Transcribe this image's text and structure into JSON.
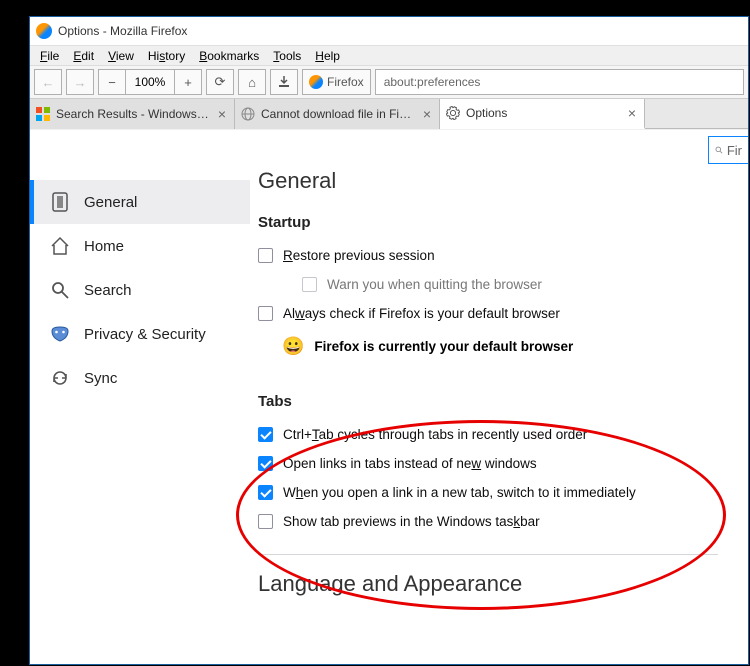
{
  "window": {
    "title": "Options - Mozilla Firefox"
  },
  "menus": [
    "File",
    "Edit",
    "View",
    "History",
    "Bookmarks",
    "Tools",
    "Help"
  ],
  "toolbar": {
    "zoom": "100%",
    "identity": "Firefox",
    "url": "about:preferences"
  },
  "tabs": [
    {
      "label": "Search Results - Windows 10 Help",
      "active": false
    },
    {
      "label": "Cannot download file in Firefox o",
      "active": false
    },
    {
      "label": "Options",
      "active": true
    }
  ],
  "search_placeholder": "Fir",
  "sidebar": [
    {
      "id": "general",
      "label": "General",
      "selected": true
    },
    {
      "id": "home",
      "label": "Home",
      "selected": false
    },
    {
      "id": "search",
      "label": "Search",
      "selected": false
    },
    {
      "id": "privacy",
      "label": "Privacy & Security",
      "selected": false
    },
    {
      "id": "sync",
      "label": "Sync",
      "selected": false
    }
  ],
  "headings": {
    "general": "General",
    "startup": "Startup",
    "tabs": "Tabs",
    "lang": "Language and Appearance"
  },
  "startup": {
    "restore": {
      "label": "Restore previous session",
      "checked": false
    },
    "warn": {
      "label": "Warn you when quitting the browser",
      "checked": false
    },
    "always_check": {
      "label": "Always check if Firefox is your default browser",
      "checked": false
    },
    "default_msg": "Firefox is currently your default browser"
  },
  "tabs_section": {
    "ctrl_tab": {
      "label": "Ctrl+Tab cycles through tabs in recently used order",
      "checked": true
    },
    "open_links": {
      "label": "Open links in tabs instead of new windows",
      "checked": true
    },
    "switch_to": {
      "label": "When you open a link in a new tab, switch to it immediately",
      "checked": true
    },
    "previews": {
      "label": "Show tab previews in the Windows taskbar",
      "checked": false
    }
  },
  "annotation": {
    "color": "#e60000"
  }
}
